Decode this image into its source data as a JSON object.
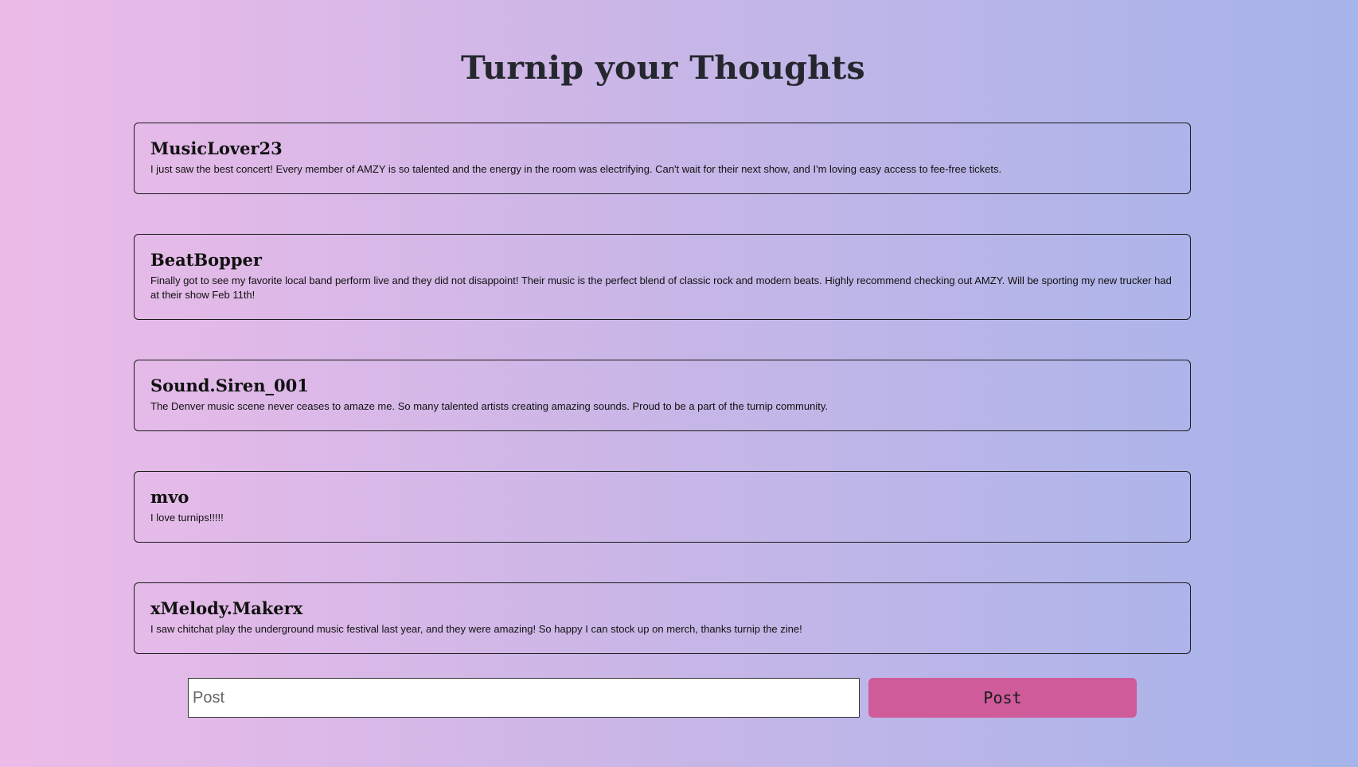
{
  "header": {
    "title": "Turnip your Thoughts"
  },
  "posts": [
    {
      "author": "MusicLover23",
      "body": "I just saw the best concert! Every member of AMZY is so talented and the energy in the room was electrifying. Can't wait for their next show, and I'm loving easy access to fee-free tickets."
    },
    {
      "author": "BeatBopper",
      "body": "Finally got to see my favorite local band perform live and they did not disappoint! Their music is the perfect blend of classic rock and modern beats. Highly recommend checking out AMZY. Will be sporting my new trucker had at their show Feb 11th!"
    },
    {
      "author": "Sound.Siren_001",
      "body": "The Denver music scene never ceases to amaze me. So many talented artists creating amazing sounds. Proud to be a part of the turnip community."
    },
    {
      "author": "mvo",
      "body": "I love turnips!!!!!"
    },
    {
      "author": "xMelody.Makerx",
      "body": "I saw chitchat play the underground music festival last year, and they were amazing! So happy I can stock up on merch, thanks turnip the zine!"
    }
  ],
  "composer": {
    "value": "",
    "placeholder": "Post",
    "button_label": "Post"
  },
  "colors": {
    "gradient_start": "#edbbe8",
    "gradient_end": "#a5b4ea",
    "button": "#cf5b9a",
    "title": "#25272e"
  }
}
